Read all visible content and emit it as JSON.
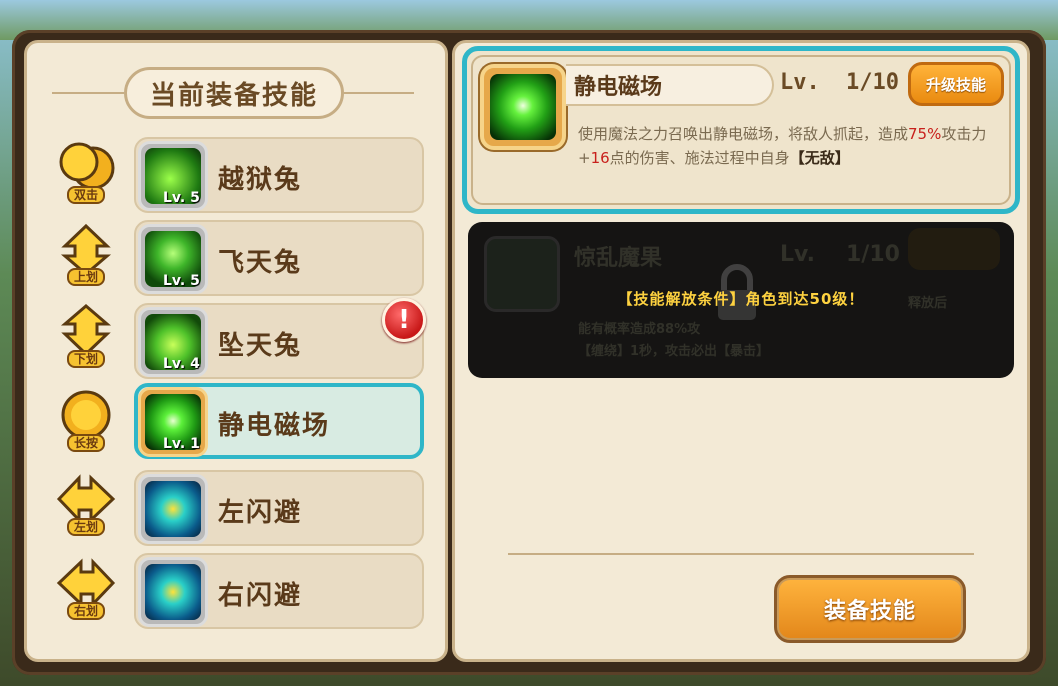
{
  "left_panel": {
    "title": "当前装备技能",
    "slots": [
      {
        "gesture_label": "双击",
        "gesture_icon": "double-tap-icon",
        "skill_name": "越狱兔",
        "level": "Lv. 5",
        "skill_icon": "green-rabbit-icon"
      },
      {
        "gesture_label": "上划",
        "gesture_icon": "swipe-up-icon",
        "skill_name": "飞天兔",
        "level": "Lv. 5",
        "skill_icon": "green-orb-rabbit-icon"
      },
      {
        "gesture_label": "下划",
        "gesture_icon": "swipe-down-icon",
        "skill_name": "坠天兔",
        "level": "Lv. 4",
        "skill_icon": "green-flame-rabbit-icon"
      },
      {
        "gesture_label": "长按",
        "gesture_icon": "long-press-icon",
        "skill_name": "静电磁场",
        "level": "Lv. 1",
        "skill_icon": "green-sphere-icon"
      },
      {
        "gesture_label": "左划",
        "gesture_icon": "swipe-left-icon",
        "skill_name": "左闪避",
        "level": "",
        "skill_icon": "dodge-left-icon"
      },
      {
        "gesture_label": "右划",
        "gesture_icon": "swipe-right-icon",
        "skill_name": "右闪避",
        "level": "",
        "skill_icon": "dodge-right-icon"
      }
    ],
    "alert_mark": "!"
  },
  "detail": {
    "skill_name": "静电磁场",
    "lv_label": "Lv.",
    "lv_value": "1/10",
    "upgrade_button": "升级技能",
    "desc_part1": "使用魔法之力召唤出静电磁场，将敌人抓起，造成",
    "desc_percent": "75%",
    "desc_part2": "攻击力+",
    "desc_points": "16",
    "desc_part3": "点的伤害、施法过程中自身",
    "desc_tag": "【无敌】"
  },
  "locked": {
    "ghost_name": "惊乱魔果",
    "ghost_lv_label": "Lv.",
    "ghost_lv_value": "1/10",
    "ghost_line1": "释放后",
    "ghost_line2": "能有概率造成88%攻",
    "ghost_line3": "【缠绕】1秒，攻击必出【暴击】",
    "unlock_condition": "【技能解放条件】角色到达50级！"
  },
  "equip_button": "装备技能",
  "colors": {
    "accent_cyan": "#2fb6c8",
    "button_orange": "#e98a10",
    "unlock_text": "#ffd23a",
    "panel_bg": "#f3ead6"
  }
}
